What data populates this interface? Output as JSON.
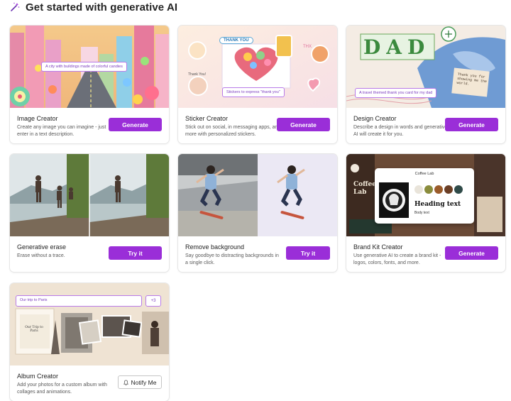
{
  "header": {
    "title": "Get started with generative AI",
    "icon": "magic-wand-icon"
  },
  "cards": [
    {
      "title": "Image Creator",
      "desc": "Create any image you can imagine - just enter in a text description.",
      "button": "Generate",
      "prompt": "A city with buildings made of colorful candies"
    },
    {
      "title": "Sticker Creator",
      "desc": "Stick out on social, in messaging apps, and more with personalized stickers.",
      "button": "Generate",
      "prompt": "Stickers to express \"thank you\"",
      "sticker_text": "THANK YOU"
    },
    {
      "title": "Design Creator",
      "desc": "Describe a design in words and generative AI will create it for you.",
      "button": "Generate",
      "prompt": "A travel themed thank you card for my dad",
      "dad_text": "DAD",
      "note_text": "Thank you for showing me the world."
    },
    {
      "title": "Generative erase",
      "desc": "Erase without a trace.",
      "button": "Try it"
    },
    {
      "title": "Remove background",
      "desc": "Say goodbye to distracting backgrounds in a single click.",
      "button": "Try it"
    },
    {
      "title": "Brand Kit Creator",
      "desc": "Use generative AI to create a brand kit - logos, colors, fonts, and more.",
      "button": "Generate",
      "panel_title": "Coffee Lab",
      "heading": "Heading text",
      "body": "Body text",
      "bg_text": "Coffee Lab",
      "swatches": [
        "#e9e4da",
        "#8a8c3c",
        "#9a5b2a",
        "#6b3e25",
        "#2f4a48"
      ]
    },
    {
      "title": "Album Creator",
      "desc": "Add your photos for a custom album with collages and animations.",
      "button": "Notify Me",
      "prompt": "Our trip to Paris",
      "badge": "+3",
      "album_cover": "Our Trip to Paris"
    }
  ],
  "colors": {
    "accent": "#9a2ed8",
    "chip_border": "#b97be8"
  }
}
